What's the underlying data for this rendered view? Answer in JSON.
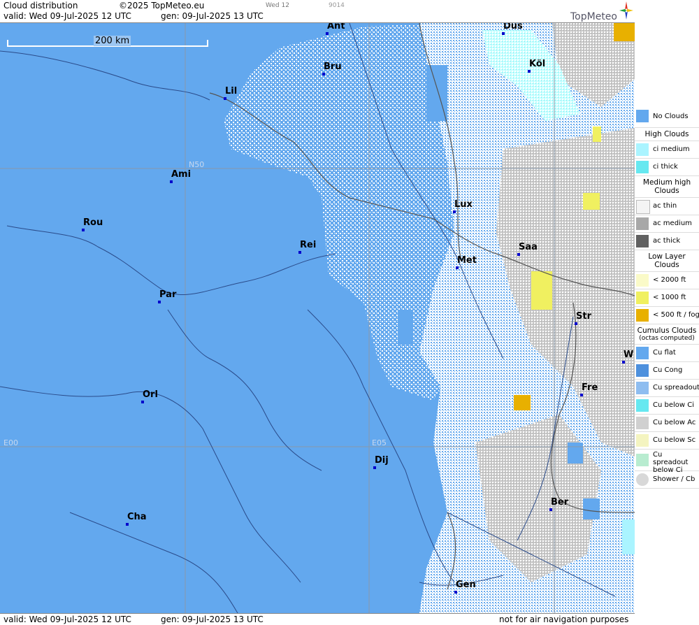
{
  "header": {
    "title": "Cloud distribution",
    "copyright": "©2025 TopMeteo.eu",
    "valid": "valid:  Wed  09-Jul-2025  12 UTC",
    "gen": "gen:  09-Jul-2025 13 UTC",
    "day_tab": "Wed 12",
    "code": "9014",
    "logo": "TopMeteo"
  },
  "footer": {
    "valid": "valid:  Wed  09-Jul-2025  12 UTC",
    "gen": "gen:  09-Jul-2025 13 UTC",
    "disclaimer": "not for air navigation purposes"
  },
  "map": {
    "scale_label": "200 km",
    "grid_labels": [
      "N50",
      "E00",
      "E05"
    ],
    "cities": [
      "Ant",
      "Düs",
      "Bru",
      "Köl",
      "Lil",
      "Ami",
      "Lux",
      "Rou",
      "Rei",
      "Saa",
      "Met",
      "Par",
      "Str",
      "W",
      "Fre",
      "Orl",
      "Dij",
      "Ber",
      "Cha",
      "Gen"
    ],
    "colors": {
      "no_clouds": "#63a8ee",
      "low_yellow": "#f0f060",
      "fog": "#e8b000"
    }
  },
  "legend": {
    "no_clouds": "No Clouds",
    "high_head": "High Clouds",
    "ci_medium": "ci medium",
    "ci_thick": "ci thick",
    "medium_head": "Medium high Clouds",
    "ac_thin": "ac thin",
    "ac_medium": "ac medium",
    "ac_thick": "ac thick",
    "low_head": "Low Layer Clouds",
    "low_2000": "< 2000 ft",
    "low_1000": "< 1000 ft",
    "low_500": "< 500 ft / fog",
    "cu_head": "Cumulus Clouds",
    "cu_sub": "(octas computed)",
    "cu_flat": "Cu flat",
    "cu_cong": "Cu Cong",
    "cu_spreadout": "Cu spreadout",
    "cu_below_ci": "Cu below Ci",
    "cu_below_ac": "Cu below Ac",
    "cu_below_sc": "Cu below Sc",
    "cu_spreadout_ci": "Cu spreadout below Ci",
    "shower": "Shower / Cb"
  }
}
